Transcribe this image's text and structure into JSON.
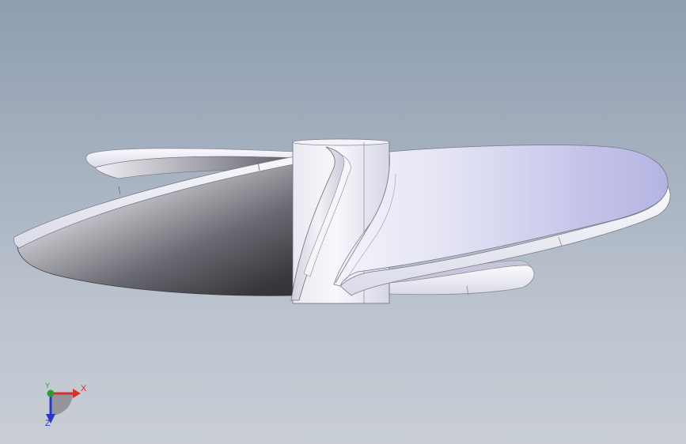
{
  "viewport": {
    "background_top": "#8f9db0",
    "background_bottom": "#c9ced6"
  },
  "model": {
    "object": "propeller",
    "face_color": "#ebebf7",
    "shadow_color": "#4a4a52"
  },
  "triad": {
    "x_label": "X",
    "y_label": "Y",
    "z_label": "Z",
    "x_color": "#d83030",
    "y_color": "#2f9a2f",
    "z_color": "#2a36c8"
  }
}
